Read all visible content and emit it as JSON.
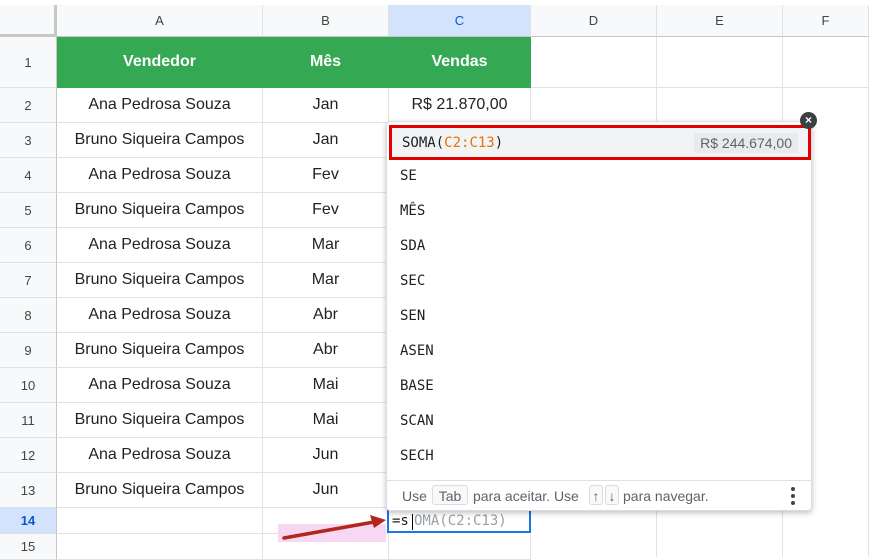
{
  "columns": [
    "A",
    "B",
    "C",
    "D",
    "E",
    "F"
  ],
  "rows": [
    "1",
    "2",
    "3",
    "4",
    "5",
    "6",
    "7",
    "8",
    "9",
    "10",
    "11",
    "12",
    "13",
    "14",
    "15"
  ],
  "headers": {
    "vendedor": "Vendedor",
    "mes": "Mês",
    "vendas": "Vendas"
  },
  "data": [
    {
      "vendedor": "Ana Pedrosa Souza",
      "mes": "Jan",
      "vendas": "R$ 21.870,00"
    },
    {
      "vendedor": "Bruno Siqueira Campos",
      "mes": "Jan",
      "vendas": ""
    },
    {
      "vendedor": "Ana Pedrosa Souza",
      "mes": "Fev",
      "vendas": ""
    },
    {
      "vendedor": "Bruno Siqueira Campos",
      "mes": "Fev",
      "vendas": ""
    },
    {
      "vendedor": "Ana Pedrosa Souza",
      "mes": "Mar",
      "vendas": ""
    },
    {
      "vendedor": "Bruno Siqueira Campos",
      "mes": "Mar",
      "vendas": ""
    },
    {
      "vendedor": "Ana Pedrosa Souza",
      "mes": "Abr",
      "vendas": ""
    },
    {
      "vendedor": "Bruno Siqueira Campos",
      "mes": "Abr",
      "vendas": ""
    },
    {
      "vendedor": "Ana Pedrosa Souza",
      "mes": "Mai",
      "vendas": ""
    },
    {
      "vendedor": "Bruno Siqueira Campos",
      "mes": "Mai",
      "vendas": ""
    },
    {
      "vendedor": "Ana Pedrosa Souza",
      "mes": "Jun",
      "vendas": ""
    },
    {
      "vendedor": "Bruno Siqueira Campos",
      "mes": "Jun",
      "vendas": ""
    }
  ],
  "autocomplete": {
    "top": {
      "fn": "SOMA(",
      "range": "C2:C13",
      "close": ")",
      "value": "R$ 244.674,00"
    },
    "items": [
      "SE",
      "MÊS",
      "SDA",
      "SEC",
      "SEN",
      "ASEN",
      "BASE",
      "SCAN",
      "SECH"
    ],
    "footer": {
      "use": "Use",
      "tab": "Tab",
      "accept": "para aceitar. Use",
      "up": "↑",
      "down": "↓",
      "navigate": "para navegar."
    },
    "close_icon": "×"
  },
  "edit_cell": {
    "typed": "=s",
    "ghost": "OMA(C2:C13)"
  },
  "colors": {
    "header_green": "#34a853",
    "highlight_red": "#e00000",
    "arrow": "#b3261e",
    "selection_blue": "#1a73e8"
  }
}
